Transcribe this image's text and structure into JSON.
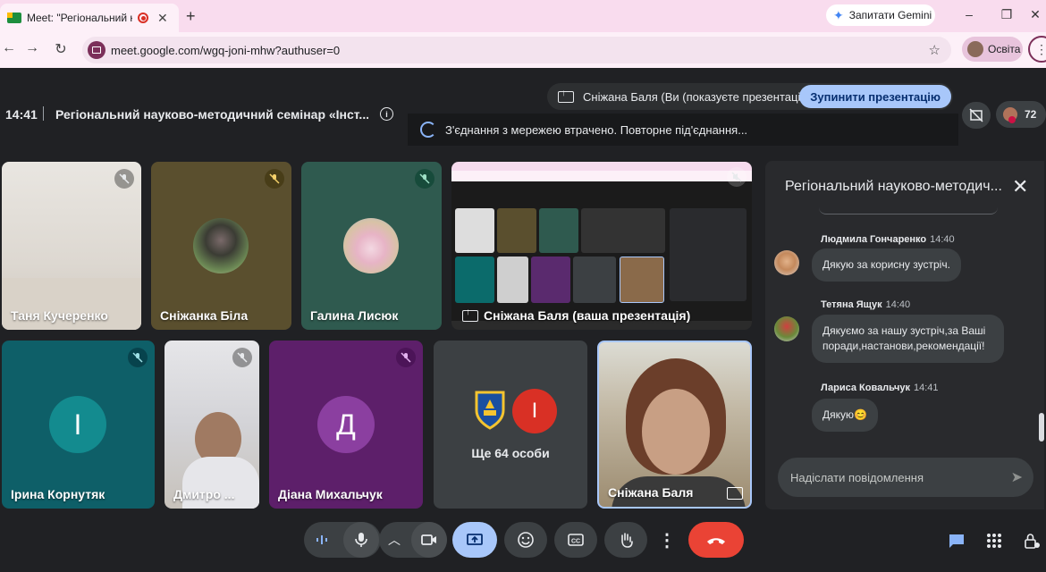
{
  "browser": {
    "tab_title": "Meet: \"Регіональний науко",
    "new_tab": "+",
    "gemini_label": "Запитати Gemini",
    "url": "meet.google.com/wgq-joni-mhw?authuser=0",
    "profile_label": "Освіта",
    "window_controls": [
      "–",
      "❐",
      "✕"
    ]
  },
  "meeting": {
    "time": "14:41",
    "title": "Регіональний науково-методичний семінар «Інст...",
    "presenting_banner": "Сніжана Баля (Ви (показуєте презентацію))",
    "stop_presenting": "Зупинити презентацію",
    "connection_status": "З'єднання з мережею втрачено. Повторне під'єднання...",
    "participants_count": "72"
  },
  "tiles": [
    {
      "name": "Таня Кучеренко"
    },
    {
      "name": "Сніжанка Біла"
    },
    {
      "name": "Галина Лисюк"
    },
    {
      "name": "Сніжана Баля (ваша презентація)"
    },
    {
      "name": "Ірина Корнутяк",
      "initial": "І"
    },
    {
      "name": "Дмитро ..."
    },
    {
      "name": "Діана Михальчук",
      "initial": "Д"
    },
    {
      "name": "Ще 64 особи",
      "initial": "І"
    },
    {
      "name": "Сніжана Баля"
    }
  ],
  "chat": {
    "title": "Регіональний науково-методич...",
    "messages": [
      {
        "sender": "Людмила Гончаренко",
        "time": "14:40",
        "text": "Дякую за корисну зустріч."
      },
      {
        "sender": "Тетяна Ящук",
        "time": "14:40",
        "text": "Дякуємо  за нашу зустріч,за Ваші поради,настанови,рекомендації!"
      },
      {
        "sender": "Лариса Ковальчук",
        "time": "14:41",
        "text": "Дякую😊"
      }
    ],
    "input_placeholder": "Надіслати повідомлення"
  },
  "colors": {
    "background": "#202124",
    "accent": "#a8c7fa",
    "end_call": "#ea4335",
    "present_active": "#a8c7fa"
  }
}
